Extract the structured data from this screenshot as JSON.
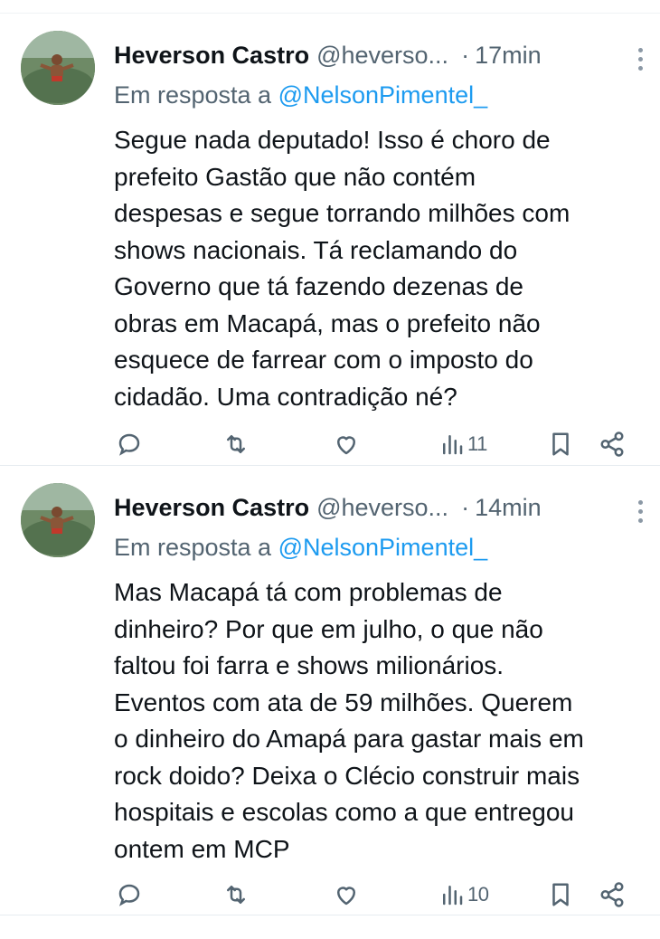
{
  "tweets": [
    {
      "author_name": "Heverson Castro",
      "handle": "@heverso...",
      "separator": "·",
      "time": "17min",
      "reply_prefix": "Em resposta a",
      "reply_to": "@NelsonPimentel_",
      "text": "Segue nada deputado! Isso é choro de prefeito Gastão que não contém despesas e segue torrando milhões com shows nacionais. Tá reclamando do Governo que tá fazendo dezenas de obras em Macapá, mas o prefeito não esquece de farrear com o imposto do cidadão. Uma contradição né?",
      "lines": [
        "Segue nada deputado! Isso é choro de",
        "prefeito Gastão que não contém",
        "despesas e segue torrando milhões com",
        "shows nacionais. Tá reclamando do",
        "Governo que tá fazendo dezenas de",
        "obras em Macapá, mas o prefeito não",
        "esquece de farrear com o imposto do",
        "cidadão. Uma contradição né?"
      ],
      "views": "11"
    },
    {
      "author_name": "Heverson Castro",
      "handle": "@heverso...",
      "separator": "·",
      "time": "14min",
      "reply_prefix": "Em resposta a",
      "reply_to": "@NelsonPimentel_",
      "lines": [
        "Mas Macapá tá com problemas de",
        "dinheiro? Por que em julho, o que não",
        "faltou foi farra e shows milionários.",
        "Eventos com ata de 59 milhões. Querem",
        "o dinheiro do Amapá para gastar mais em",
        "rock doido? Deixa o Clécio construir mais",
        "hospitais e escolas como a que entregou",
        "ontem em MCP"
      ],
      "views": "10"
    }
  ],
  "icons": {
    "reply": "reply-icon",
    "retweet": "retweet-icon",
    "like": "like-icon",
    "views": "views-icon",
    "bookmark": "bookmark-icon",
    "share": "share-icon",
    "more": "more-icon"
  },
  "colors": {
    "text": "#0f1419",
    "secondary": "#536471",
    "link": "#1d9bf0",
    "divider": "#e6ecf0"
  }
}
